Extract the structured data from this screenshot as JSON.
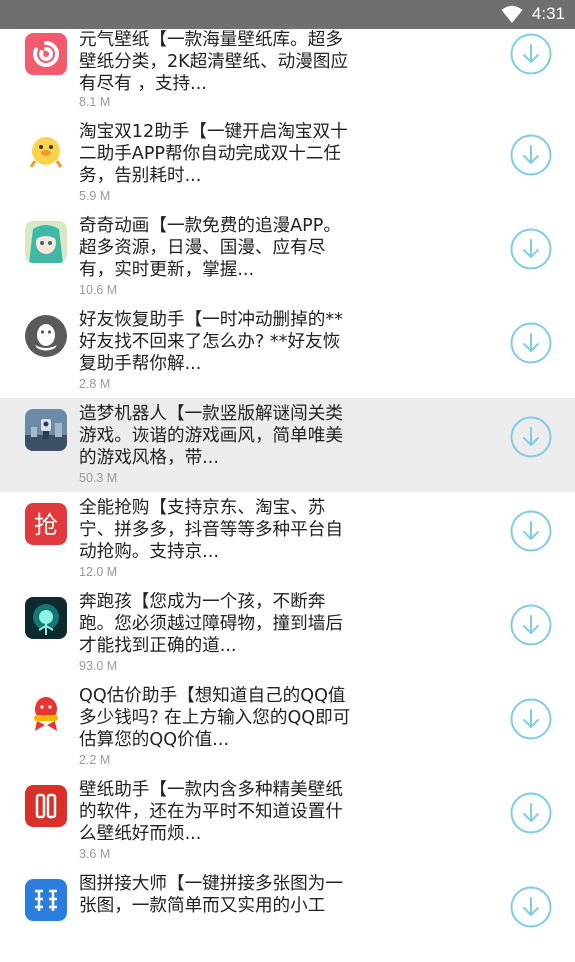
{
  "status_bar": {
    "time": "4:31"
  },
  "colors": {
    "accent": "#7fcce6",
    "status_bar_bg": "#6f6f6f",
    "highlight_row": "#ececec",
    "secondary_text": "#9a9a9a"
  },
  "apps": [
    {
      "icon": "swirl-logo-icon",
      "line1": "元气壁纸【一款海量壁纸库。超多",
      "line2": "壁纸分类，2K超清壁纸、动漫图应",
      "line3": "有尽有 ，支持...",
      "size": "8.1 M"
    },
    {
      "icon": "duck-mascot-icon",
      "line1": "淘宝双12助手【一键开启淘宝双十",
      "line2": "二助手APP帮你自动完成双十二任",
      "line3": "务，告别耗时...",
      "size": "5.9 M"
    },
    {
      "icon": "anime-character-icon",
      "line1": "奇奇动画【一款免费的追漫APP。",
      "line2": "超多资源，日漫、国漫、应有尽",
      "line3": "有，实时更新，掌握...",
      "size": "10.6 M"
    },
    {
      "icon": "qq-penguin-icon",
      "line1": "好友恢复助手【一时冲动删掉的**",
      "line2": "好友找不回来了怎么办? **好友恢",
      "line3": "复助手帮你解...",
      "size": "2.8 M"
    },
    {
      "icon": "dream-machine-game-icon",
      "line1": "造梦机器人【一款竖版解谜闯关类",
      "line2": "游戏。诙谐的游戏画风，简单唯美",
      "line3": "的游戏风格，带...",
      "size": "50.3 M"
    },
    {
      "icon": "grab-qiang-icon",
      "line1": "全能抢购【支持京东、淘宝、苏",
      "line2": "宁、拼多多，抖音等等多种平台自",
      "line3": "动抢购。支持京...",
      "size": "12.0 M"
    },
    {
      "icon": "running-boy-glow-icon",
      "line1": "奔跑孩【您成为一个孩，不断奔",
      "line2": "跑。您必须越过障碍物，撞到墙后",
      "line3": "才能找到正确的道...",
      "size": "93.0 M"
    },
    {
      "icon": "qq-red-scarf-icon",
      "line1": "QQ估价助手【想知道自己的QQ值",
      "line2": "多少钱吗? 在上方输入您的QQ即可",
      "line3": "估算您的QQ价值...",
      "size": "2.2 M"
    },
    {
      "icon": "wallpaper-assistant-icon",
      "line1": "壁纸助手【一款内含多种精美壁纸",
      "line2": "的软件，还在为平时不知道设置什",
      "line3": "么壁纸好而烦...",
      "size": "3.6 M"
    },
    {
      "icon": "image-stitch-icon",
      "line1": "图拼接大师【一键拼接多张图为一",
      "line2": "张图，一款简单而又实用的小工",
      "line3": "",
      "size": ""
    }
  ],
  "download_icon": "download-arrow-icon"
}
